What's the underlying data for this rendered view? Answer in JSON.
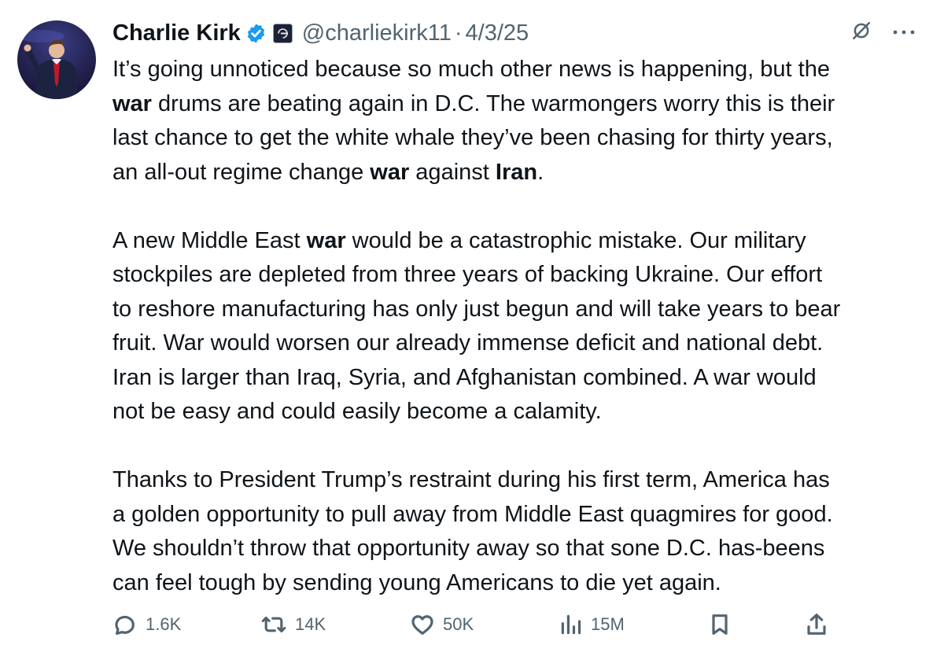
{
  "author": {
    "name": "Charlie Kirk",
    "handle": "@charliekirk11",
    "separator": "·",
    "date": "4/3/25"
  },
  "colors": {
    "verified_badge": "#1d9bf0",
    "text_primary": "#0f1419",
    "text_secondary": "#536471"
  },
  "icons": {
    "verified": "verified-badge-icon",
    "affiliation": "affiliation-badge-icon",
    "grok": "grok-icon",
    "more": "more-icon",
    "reply": "reply-icon",
    "repost": "repost-icon",
    "like": "like-icon",
    "views": "views-icon",
    "bookmark": "bookmark-icon",
    "share": "share-icon"
  },
  "tweet": {
    "lines": [
      {
        "segments": [
          {
            "text": "It’s going unnoticed because so much other news is happening, but the",
            "bold": false
          }
        ]
      },
      {
        "segments": [
          {
            "text": "war",
            "bold": true
          },
          {
            "text": " drums are beating again in D.C. The warmongers worry this is their",
            "bold": false
          }
        ]
      },
      {
        "segments": [
          {
            "text": "last chance to get the white whale they’ve been chasing for thirty years,",
            "bold": false
          }
        ]
      },
      {
        "segments": [
          {
            "text": "an all-out regime change ",
            "bold": false
          },
          {
            "text": "war",
            "bold": true
          },
          {
            "text": " against ",
            "bold": false
          },
          {
            "text": "Iran",
            "bold": true
          },
          {
            "text": ".",
            "bold": false
          }
        ],
        "para_end": true
      },
      {
        "segments": [
          {
            "text": "A new Middle East ",
            "bold": false
          },
          {
            "text": "war",
            "bold": true
          },
          {
            "text": " would be a catastrophic mistake. Our military",
            "bold": false
          }
        ]
      },
      {
        "segments": [
          {
            "text": "stockpiles are depleted from three years of backing Ukraine. Our effort",
            "bold": false
          }
        ]
      },
      {
        "segments": [
          {
            "text": "to reshore manufacturing has only just begun and will take years to bear",
            "bold": false
          }
        ]
      },
      {
        "segments": [
          {
            "text": "fruit. War would worsen our already immense deficit and national debt.",
            "bold": false
          }
        ]
      },
      {
        "segments": [
          {
            "text": "Iran is larger than Iraq, Syria, and Afghanistan combined. A war would",
            "bold": false
          }
        ]
      },
      {
        "segments": [
          {
            "text": "not be easy and could easily become a calamity.",
            "bold": false
          }
        ],
        "para_end": true
      },
      {
        "segments": [
          {
            "text": "Thanks to President Trump’s restraint during his first term, America has",
            "bold": false
          }
        ]
      },
      {
        "segments": [
          {
            "text": "a golden opportunity to pull away from Middle East quagmires for good.",
            "bold": false
          }
        ]
      },
      {
        "segments": [
          {
            "text": "We shouldn’t throw that opportunity away so that sone D.C. has-beens",
            "bold": false
          }
        ]
      },
      {
        "segments": [
          {
            "text": "can feel tough by sending young Americans to die yet again.",
            "bold": false
          }
        ]
      }
    ]
  },
  "stats": {
    "replies": "1.6K",
    "reposts": "14K",
    "likes": "50K",
    "views": "15M"
  }
}
